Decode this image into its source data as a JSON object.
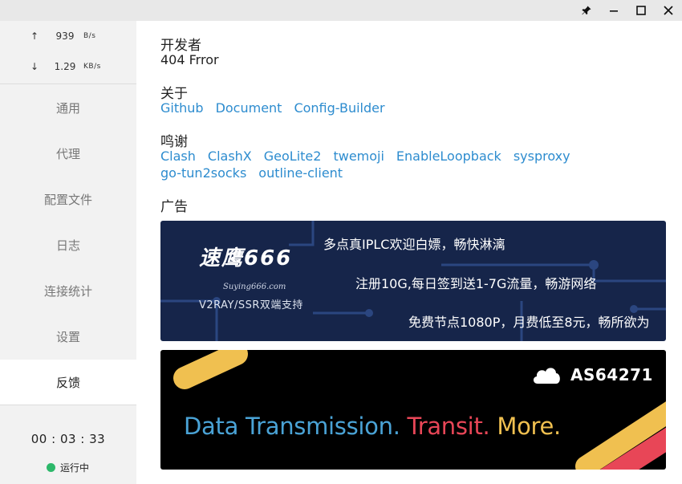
{
  "window": {
    "pin_icon": "pin-icon",
    "minimize_icon": "minimize-icon",
    "maximize_icon": "maximize-icon",
    "close_icon": "close-icon"
  },
  "sidebar": {
    "upload": {
      "arrow": "↑",
      "value": "939",
      "unit": "B/s"
    },
    "download": {
      "arrow": "↓",
      "value": "1.29",
      "unit": "KB/s"
    },
    "items": [
      {
        "label": "通用"
      },
      {
        "label": "代理"
      },
      {
        "label": "配置文件"
      },
      {
        "label": "日志"
      },
      {
        "label": "连接统计"
      },
      {
        "label": "设置"
      },
      {
        "label": "反馈",
        "active": true
      }
    ],
    "timer": "00 : 03 : 33",
    "status": "运行中",
    "status_color": "#2db86a"
  },
  "main": {
    "developer": {
      "title": "开发者",
      "value": "404 Frror"
    },
    "about": {
      "title": "关于",
      "links": [
        "Github",
        "Document",
        "Config-Builder"
      ]
    },
    "thanks": {
      "title": "鸣谢",
      "links_row1": [
        "Clash",
        "ClashX",
        "GeoLite2",
        "twemoji",
        "EnableLoopback",
        "sysproxy"
      ],
      "links_row2": [
        "go-tun2socks",
        "outline-client"
      ]
    },
    "ads": {
      "title": "广告",
      "ad1": {
        "brand": "速鹰666",
        "site": "Suying666.com",
        "sub": "V2RAY/SSR双端支持",
        "line1": "多点真IPLC欢迎白嫖，畅快淋漓",
        "line2": "注册10G,每日签到送1-7G流量，畅游网络",
        "line3": "免费节点1080P，月费低至8元，畅所欲为"
      },
      "ad2": {
        "asn": "AS64271",
        "tag_part1": "Data Transmission.",
        "tag_part2": "Transit.",
        "tag_part3": "More."
      }
    }
  },
  "colors": {
    "link": "#2d8ccf",
    "ad1_bg": "#16254a",
    "ad2_blue": "#4aa3d6",
    "ad2_red": "#e84657",
    "ad2_yellow": "#f0c050"
  }
}
